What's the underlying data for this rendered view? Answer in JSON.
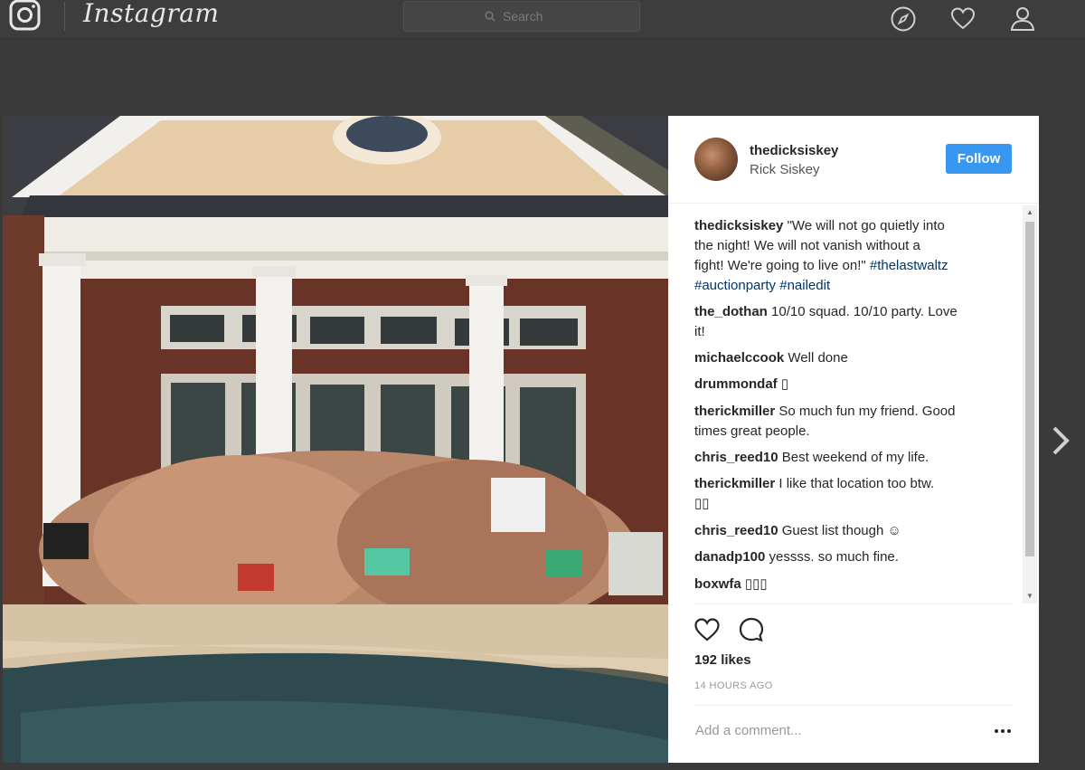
{
  "topbar": {
    "wordmark": "Instagram",
    "search_placeholder": "Search"
  },
  "post": {
    "username": "thedicksiskey",
    "full_name": "Rick Siskey",
    "follow_label": "Follow",
    "caption": {
      "user": "thedicksiskey",
      "line1": "\"We will not go quietly into",
      "line2": "the night! We will not vanish without a",
      "line3": "fight! We're going to live on!\" ",
      "tag1": "#thelastwaltz",
      "tag2": "#auctionparty",
      "tag3": "#nailedit"
    },
    "comments": [
      {
        "user": "the_dothan",
        "text": "10/10 squad. 10/10 party. Love",
        "text2": "it!"
      },
      {
        "user": "michaelccook",
        "text": "Well done"
      },
      {
        "user": "drummondaf",
        "text": "▯"
      },
      {
        "user": "therickmiller",
        "text": "So much fun my friend. Good",
        "text2": "times great people."
      },
      {
        "user": "chris_reed10",
        "text": "Best weekend of my life."
      },
      {
        "user": "therickmiller",
        "text": "I like that location too btw.",
        "text2": "▯▯"
      },
      {
        "user": "chris_reed10",
        "text": "Guest list though ☺"
      },
      {
        "user": "danadp100",
        "text": "yessss. so much fine."
      },
      {
        "user": "boxwfa",
        "text": "▯▯▯"
      }
    ],
    "likes": "192 likes",
    "timestamp": "14 HOURS AGO",
    "add_comment_placeholder": "Add a comment..."
  },
  "colors": {
    "follow_blue": "#3897f0",
    "hashtag": "#003569",
    "page_dim": "#3a3a3a"
  },
  "icons": [
    "instagram-logo-icon",
    "search-icon",
    "compass-icon",
    "heart-icon",
    "person-icon",
    "like-icon",
    "comment-icon",
    "more-icon",
    "chevron-right-icon"
  ]
}
